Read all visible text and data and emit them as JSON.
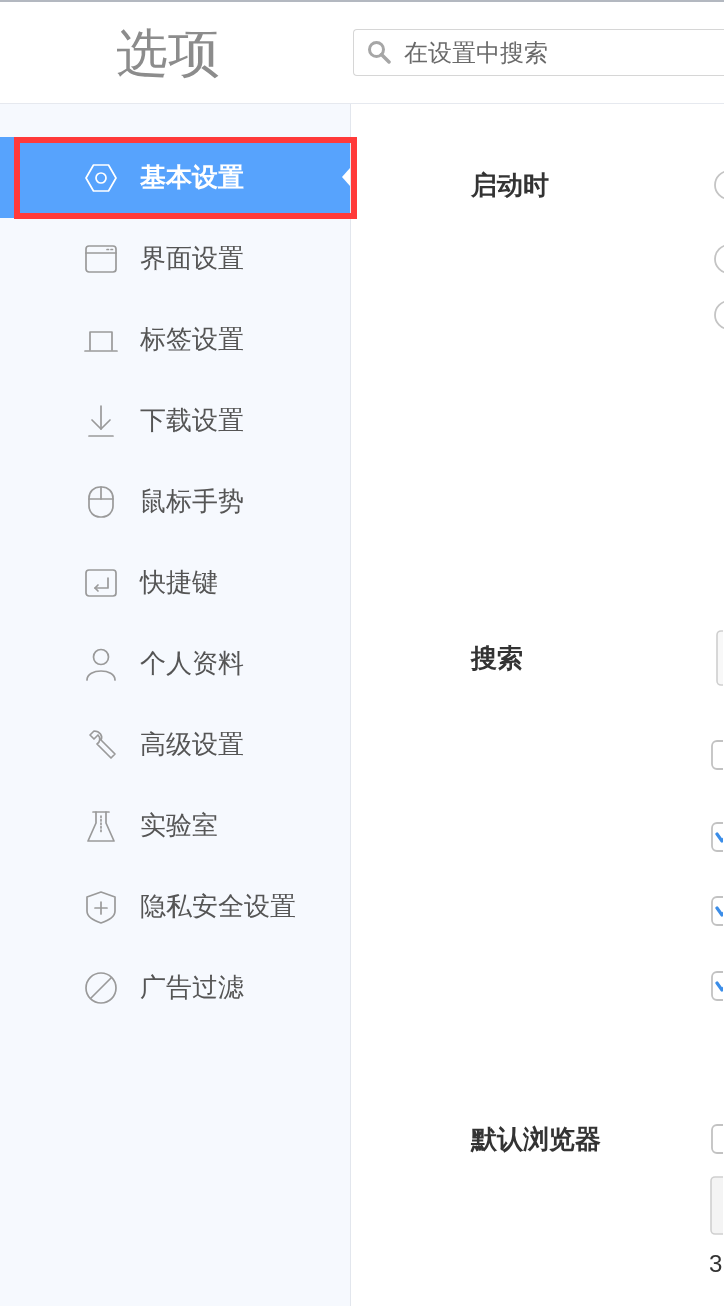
{
  "header": {
    "title": "选项",
    "search": {
      "placeholder": "在设置中搜索"
    }
  },
  "sidebar": {
    "items": [
      {
        "label": "基本设置",
        "selected": true,
        "annotated": true
      },
      {
        "label": "界面设置",
        "selected": false,
        "annotated": false
      },
      {
        "label": "标签设置",
        "selected": false,
        "annotated": false
      },
      {
        "label": "下载设置",
        "selected": false,
        "annotated": false
      },
      {
        "label": "鼠标手势",
        "selected": false,
        "annotated": false
      },
      {
        "label": "快捷键",
        "selected": false,
        "annotated": false
      },
      {
        "label": "个人资料",
        "selected": false,
        "annotated": false
      },
      {
        "label": "高级设置",
        "selected": false,
        "annotated": false
      },
      {
        "label": "实验室",
        "selected": false,
        "annotated": false
      },
      {
        "label": "隐私安全设置",
        "selected": false,
        "annotated": false
      },
      {
        "label": "广告过滤",
        "selected": false,
        "annotated": false
      }
    ]
  },
  "content": {
    "sections": [
      {
        "title": "启动时",
        "controls": [
          {
            "kind": "radio",
            "selected": false
          },
          {
            "kind": "radio",
            "selected": false
          },
          {
            "kind": "radio",
            "selected": false
          }
        ]
      },
      {
        "title": "搜索",
        "controls": [
          {
            "kind": "select"
          },
          {
            "kind": "checkbox",
            "checked": false
          },
          {
            "kind": "checkbox",
            "checked": true
          },
          {
            "kind": "checkbox",
            "checked": true
          },
          {
            "kind": "checkbox",
            "checked": true
          }
        ]
      },
      {
        "title": "默认浏览器",
        "controls": [
          {
            "kind": "checkbox",
            "checked": false
          },
          {
            "kind": "button"
          },
          {
            "kind": "text",
            "text": "3"
          }
        ]
      }
    ]
  }
}
